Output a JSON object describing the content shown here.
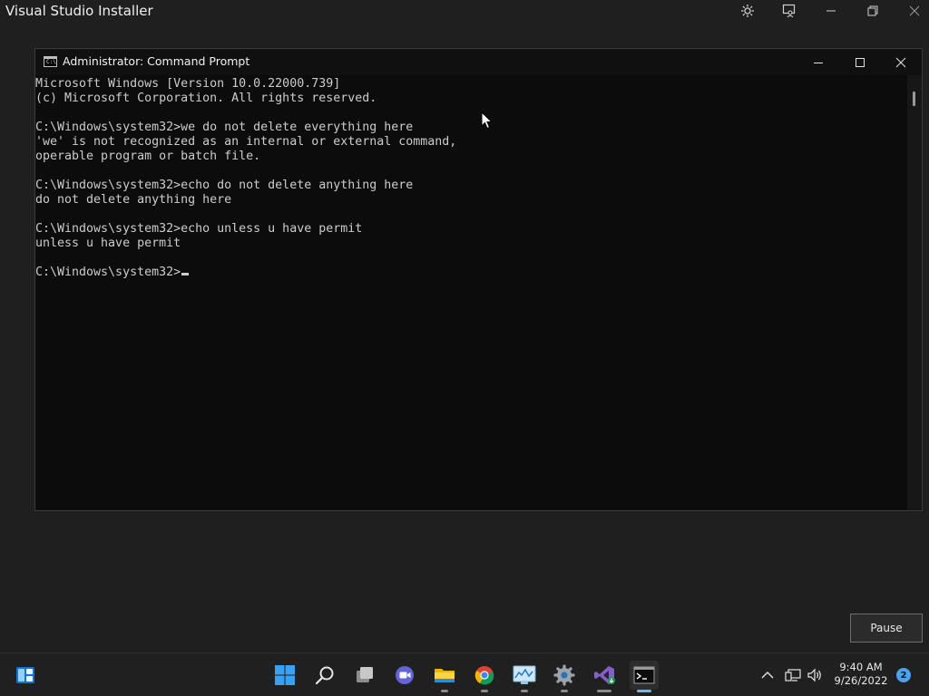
{
  "background_window": {
    "title": "Visual Studio Installer",
    "controls": [
      "settings-icon",
      "feedback-icon",
      "minimize-icon",
      "restore-icon",
      "close-icon"
    ]
  },
  "cmd": {
    "title": "Administrator: Command Prompt",
    "app_icon_text": "C:\\",
    "lines": [
      "Microsoft Windows [Version 10.0.22000.739]",
      "(c) Microsoft Corporation. All rights reserved.",
      "",
      "C:\\Windows\\system32>we do not delete everything here",
      "'we' is not recognized as an internal or external command,",
      "operable program or batch file.",
      "",
      "C:\\Windows\\system32>echo do not delete anything here",
      "do not delete anything here",
      "",
      "C:\\Windows\\system32>echo unless u have permit",
      "unless u have permit",
      "",
      "C:\\Windows\\system32>"
    ]
  },
  "pause_button": {
    "label": "Pause"
  },
  "taskbar": {
    "apps": [
      {
        "name": "widgets",
        "icon": "widgets-icon"
      },
      {
        "name": "start",
        "icon": "windows-start-icon"
      },
      {
        "name": "search",
        "icon": "search-icon"
      },
      {
        "name": "task-view",
        "icon": "task-view-icon"
      },
      {
        "name": "teams-chat",
        "icon": "teams-chat-icon"
      },
      {
        "name": "file-explorer",
        "icon": "file-explorer-icon"
      },
      {
        "name": "chrome",
        "icon": "chrome-icon"
      },
      {
        "name": "resource-monitor",
        "icon": "resource-monitor-icon"
      },
      {
        "name": "settings",
        "icon": "settings-icon"
      },
      {
        "name": "visual-studio",
        "icon": "visual-studio-icon"
      },
      {
        "name": "command-prompt",
        "icon": "command-prompt-icon"
      }
    ],
    "tray": {
      "clock_time": "9:40 AM",
      "clock_date": "9/26/2022",
      "notifications_count": "2"
    }
  },
  "colors": {
    "desktop_bg": "#1f1f1f",
    "console_bg": "#0c0c0c",
    "console_text": "#cccccc",
    "accent": "#4aa3ef"
  }
}
